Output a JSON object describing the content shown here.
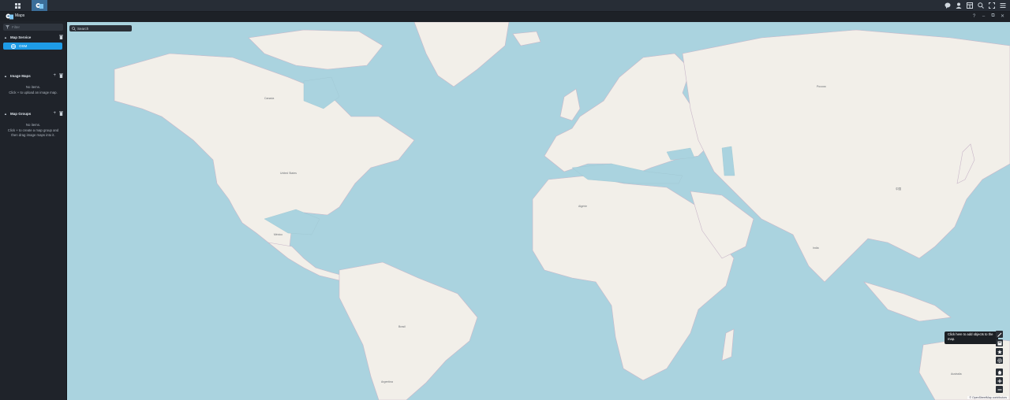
{
  "app": {
    "title": "Maps"
  },
  "sidebar": {
    "filter_placeholder": "Filter",
    "sections": [
      {
        "title": "Map Service",
        "items": [
          {
            "label": "OSM"
          }
        ]
      },
      {
        "title": "Image Maps",
        "empty_line1": "No items.",
        "empty_line2": "Click + to upload an image map."
      },
      {
        "title": "Map Groups",
        "empty_line1": "No items.",
        "empty_line2": "Click + to create a map group and",
        "empty_line3": "then drag image maps into it."
      }
    ]
  },
  "map": {
    "search_label": "Search",
    "tooltip": "Click here to add objects to the map.",
    "attribution": "© OpenStreetMap contributors",
    "places": [
      "Canada",
      "United States",
      "México",
      "Brasil",
      "Россия",
      "中国",
      "Australia",
      "Argentina",
      "India",
      "Algérie"
    ]
  },
  "icons": {
    "taskbar": [
      "apps-grid-icon",
      "maps-app-icon"
    ],
    "taskbar_right": [
      "chat-icon",
      "user-icon",
      "widgets-icon",
      "search-icon",
      "fullscreen-icon",
      "menu-icon"
    ],
    "window": [
      "help-icon",
      "minimize-icon",
      "restore-icon",
      "close-icon"
    ],
    "map_tools": [
      "pencil-icon",
      "layers-icon",
      "star-icon",
      "gear-icon",
      "home-icon",
      "zoom-in-icon",
      "zoom-out-icon"
    ]
  },
  "colors": {
    "accent": "#1e9be6",
    "water": "#aad3df",
    "land": "#f2efe9",
    "panel": "#1f232a"
  }
}
